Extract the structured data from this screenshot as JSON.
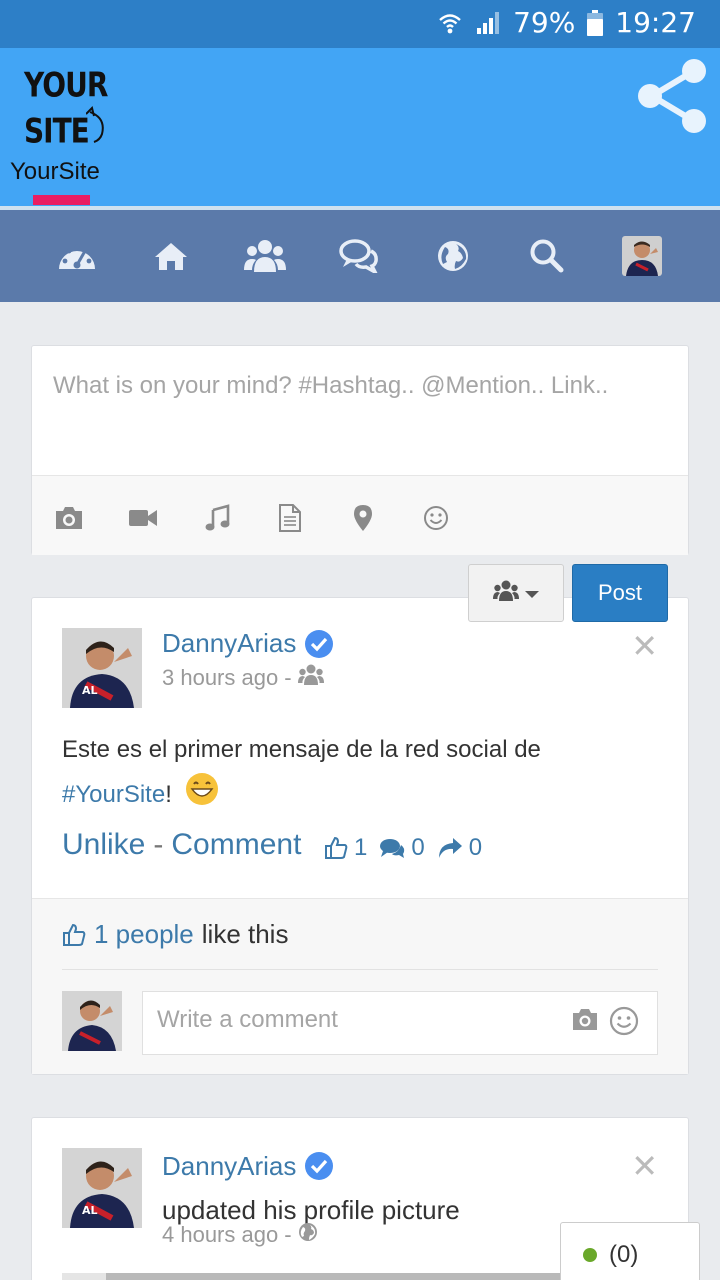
{
  "status_bar": {
    "battery": "79%",
    "time": "19:27",
    "icons": [
      "wifi-icon",
      "signal-icon",
      "battery-icon"
    ]
  },
  "header": {
    "logo_line1": "YOUR",
    "logo_line2": "SITE",
    "site_name": "YourSite",
    "accent_color": "#e91e63",
    "header_color": "#42a5f5",
    "share_icon": "share-icon"
  },
  "nav": {
    "color": "#5b7aaa",
    "items": [
      "dashboard-icon",
      "home-icon",
      "groups-icon",
      "messages-icon",
      "globe-icon",
      "search-icon",
      "profile-avatar"
    ]
  },
  "composer": {
    "placeholder": "What is on your mind? #Hashtag.. @Mention.. Link..",
    "tools": [
      "camera-icon",
      "video-icon",
      "music-icon",
      "file-icon",
      "location-icon",
      "smiley-icon"
    ],
    "post_label": "Post",
    "privacy_icon": "group-icon"
  },
  "posts": [
    {
      "author": "DannyArias",
      "time": "3 hours ago",
      "separator": "-",
      "privacy_icon": "group-icon",
      "text_before": "Este es el primer mensaje de la red social de",
      "hashtag": "#YourSite",
      "text_after": "!",
      "like_action": "Unlike",
      "action_sep": "-",
      "comment_action": "Comment",
      "likes_count": "1",
      "comments_count": "0",
      "shares_count": "0",
      "likes_people": "1 people",
      "likes_suffix": "like this",
      "comment_placeholder": "Write a comment"
    },
    {
      "author": "DannyArias",
      "action_text": "updated his profile picture",
      "time": "4 hours ago",
      "separator": "-",
      "privacy_icon": "globe-icon"
    }
  ],
  "chat": {
    "count": "(0)",
    "status_color": "#6aa82a"
  }
}
